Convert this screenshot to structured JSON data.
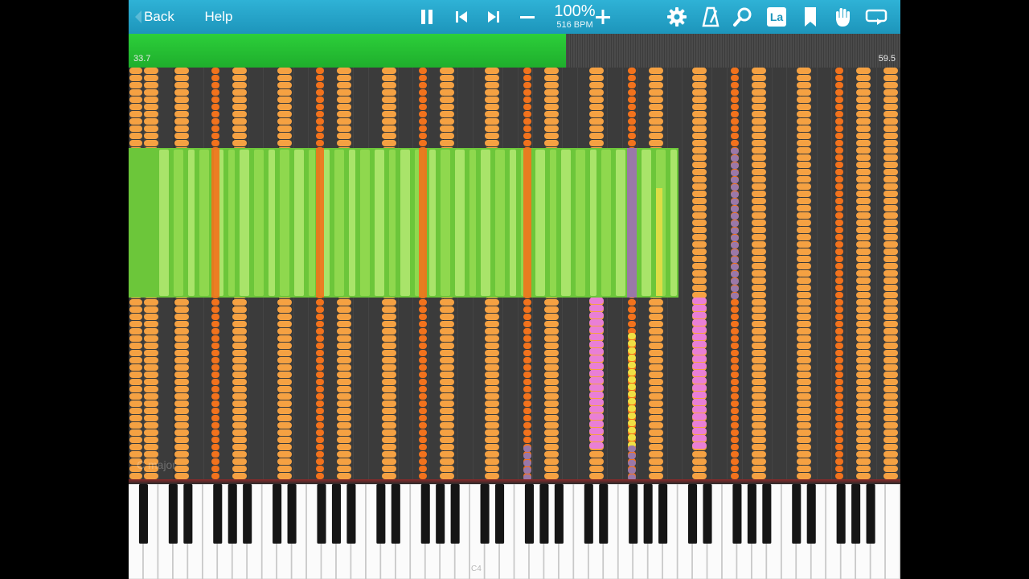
{
  "toolbar": {
    "back_label": "Back",
    "help_label": "Help",
    "tempo_percent": "100%",
    "tempo_bpm": "516 BPM",
    "icons": [
      "pause-icon",
      "skip-back-icon",
      "skip-forward-icon",
      "minus-icon",
      "plus-icon",
      "gear-icon",
      "metronome-icon",
      "magnifier-icon",
      "label-icon",
      "bookmark-icon",
      "hand-icon",
      "loop-icon"
    ],
    "label_icon_text": "La"
  },
  "progress": {
    "start_label": "33.7",
    "end_label": "59.5",
    "fraction": 0.567
  },
  "roll": {
    "key_label": "C major",
    "colors": {
      "orange_light": "#f5a142",
      "orange_dark": "#f2721c",
      "green_light": "#a9e46a",
      "green_dark": "#6cc63a",
      "pink": "#e97fd6",
      "purple": "#9a78a8",
      "yellow": "#efe044"
    }
  },
  "keyboard": {
    "octave_labels": [
      "C4"
    ]
  }
}
